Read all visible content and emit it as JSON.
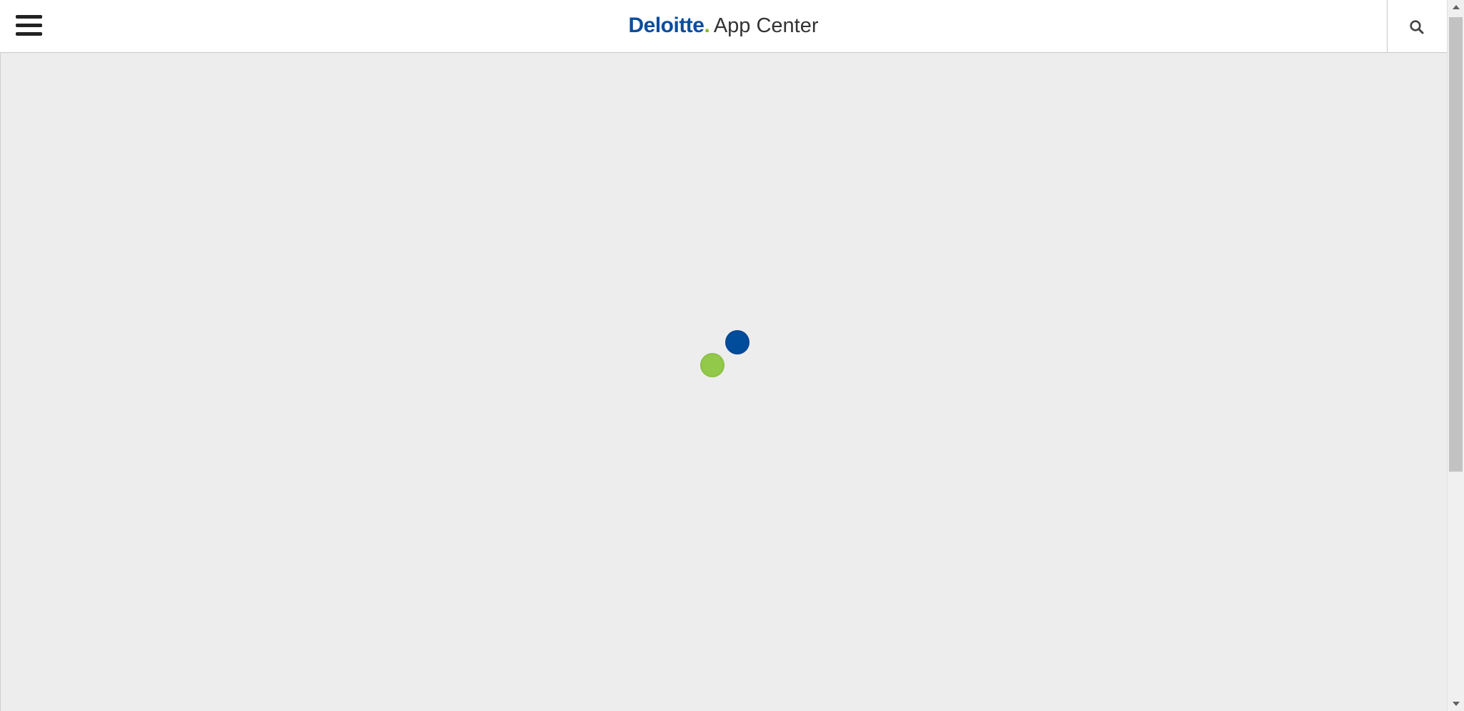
{
  "header": {
    "menu_icon": "hamburger-menu-icon",
    "logo": {
      "brand": "Deloitte",
      "brand_dot": ".",
      "app_name": "App Center"
    },
    "search_icon": "search-icon"
  },
  "main": {
    "loader": {
      "state": "loading",
      "icon": "loading-spinner-icon"
    }
  },
  "scrollbar": {
    "up_icon": "scroll-up-arrow-icon",
    "down_icon": "scroll-down-arrow-icon"
  },
  "colors": {
    "brand_blue": "#0a4d9c",
    "brand_green": "#86bc25",
    "loader_blue": "#024c9c",
    "loader_green": "#92c94a",
    "page_background": "#ededed",
    "header_background": "#ffffff"
  }
}
